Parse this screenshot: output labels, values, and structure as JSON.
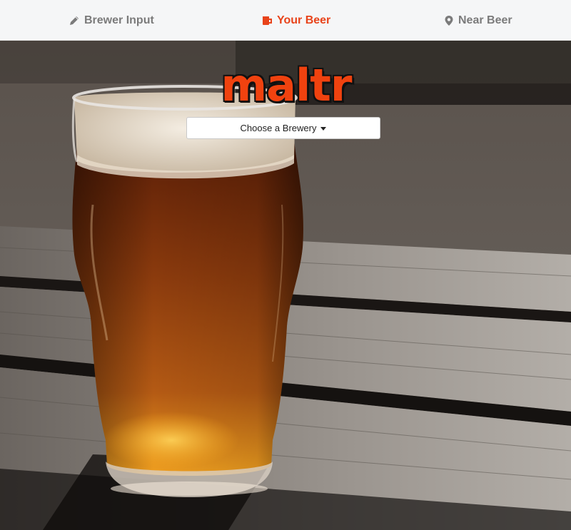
{
  "nav": {
    "items": [
      {
        "label": "Brewer Input",
        "icon": "pencil-icon",
        "active": false
      },
      {
        "label": "Your Beer",
        "icon": "beer-mug-icon",
        "active": true
      },
      {
        "label": "Near Beer",
        "icon": "map-pin-icon",
        "active": false
      }
    ]
  },
  "logo": {
    "text": "maltr"
  },
  "brewery_select": {
    "label": "Choose a Brewery",
    "icon": "caret-down-icon"
  },
  "colors": {
    "accent": "#e8431a",
    "nav_background": "#f5f6f7",
    "nav_text": "#7b7b7b",
    "logo_fill": "#f0420f",
    "logo_outline": "#111111"
  }
}
